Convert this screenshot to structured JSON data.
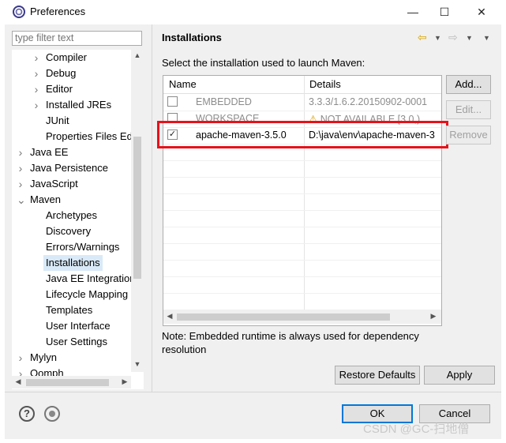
{
  "window": {
    "title": "Preferences"
  },
  "filter": {
    "placeholder": "type filter text"
  },
  "tree": [
    {
      "label": "Compiler",
      "level": 2,
      "arrow": "›"
    },
    {
      "label": "Debug",
      "level": 2,
      "arrow": "›"
    },
    {
      "label": "Editor",
      "level": 2,
      "arrow": "›"
    },
    {
      "label": "Installed JREs",
      "level": 2,
      "arrow": "›"
    },
    {
      "label": "JUnit",
      "level": 2,
      "arrow": ""
    },
    {
      "label": "Properties Files Ed",
      "level": 2,
      "arrow": ""
    },
    {
      "label": "Java EE",
      "level": 1,
      "arrow": "›"
    },
    {
      "label": "Java Persistence",
      "level": 1,
      "arrow": "›"
    },
    {
      "label": "JavaScript",
      "level": 1,
      "arrow": "›"
    },
    {
      "label": "Maven",
      "level": 1,
      "arrow": "⌄"
    },
    {
      "label": "Archetypes",
      "level": 2,
      "arrow": ""
    },
    {
      "label": "Discovery",
      "level": 2,
      "arrow": ""
    },
    {
      "label": "Errors/Warnings",
      "level": 2,
      "arrow": ""
    },
    {
      "label": "Installations",
      "level": 2,
      "arrow": "",
      "selected": true
    },
    {
      "label": "Java EE Integration",
      "level": 2,
      "arrow": ""
    },
    {
      "label": "Lifecycle Mapping",
      "level": 2,
      "arrow": ""
    },
    {
      "label": "Templates",
      "level": 2,
      "arrow": ""
    },
    {
      "label": "User Interface",
      "level": 2,
      "arrow": ""
    },
    {
      "label": "User Settings",
      "level": 2,
      "arrow": ""
    },
    {
      "label": "Mylyn",
      "level": 1,
      "arrow": "›"
    },
    {
      "label": "Oomph",
      "level": 1,
      "arrow": "›"
    }
  ],
  "page": {
    "title": "Installations",
    "description": "Select the installation used to launch Maven:",
    "columns": [
      "Name",
      "Details"
    ],
    "rows": [
      {
        "checked": false,
        "name": "EMBEDDED",
        "details": "3.3.3/1.6.2.20150902-0001",
        "dim": true,
        "warning": false
      },
      {
        "checked": false,
        "name": "WORKSPACE",
        "details": "NOT AVAILABLE [3.0,)",
        "dim": true,
        "warning": true
      },
      {
        "checked": true,
        "name": "apache-maven-3.5.0",
        "details": "D:\\java\\env\\apache-maven-3",
        "dim": false,
        "warning": false
      }
    ],
    "buttons": {
      "add": "Add...",
      "edit": "Edit...",
      "remove": "Remove"
    },
    "note": "Note: Embedded runtime is always used for dependency resolution",
    "restore_defaults": "Restore Defaults",
    "apply": "Apply"
  },
  "dialog": {
    "ok": "OK",
    "cancel": "Cancel"
  },
  "watermark": "CSDN @GC-扫地僧",
  "colors": {
    "highlight_box": "#e8121a",
    "selection": "#d9e9f7",
    "default_button_border": "#0078d7"
  }
}
